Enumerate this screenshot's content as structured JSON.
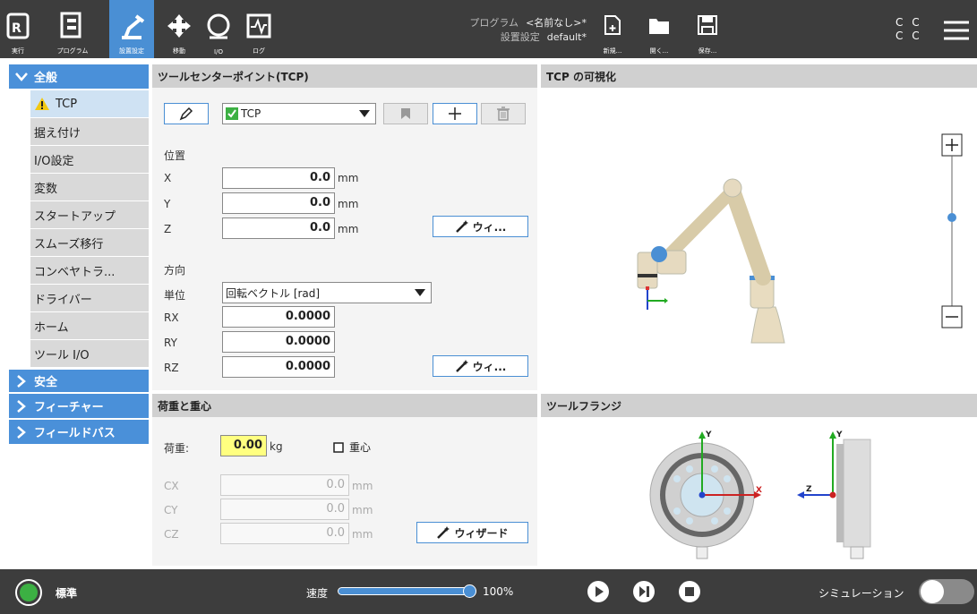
{
  "topbar": {
    "run": "実行",
    "program": "プログラム",
    "installation": "設置設定",
    "move": "移動",
    "io": "I/O",
    "log": "ログ",
    "program_label": "プログラム",
    "program_value": "<名前なし>*",
    "install_label": "設置設定",
    "install_value": "default*",
    "new": "新規...",
    "open": "開く...",
    "save": "保存...",
    "cc1": "C C",
    "cc2": "C C"
  },
  "sidebar": {
    "general": "全般",
    "items": [
      "TCP",
      "据え付け",
      "I/O設定",
      "変数",
      "スタートアップ",
      "スムーズ移行",
      "コンベヤトラ...",
      "ドライバー",
      "ホーム",
      "ツール I/O"
    ],
    "safety": "安全",
    "features": "フィーチャー",
    "fieldbus": "フィールドバス"
  },
  "tcp": {
    "title": "ツールセンターポイント(TCP)",
    "dropdown": "TCP",
    "position": "位置",
    "x_label": "X",
    "x": "0.0",
    "y_label": "Y",
    "y": "0.0",
    "z_label": "Z",
    "z": "0.0",
    "unit_mm": "mm",
    "wizard_short": "ウィ...",
    "orientation": "方向",
    "unit_label": "単位",
    "unit_value": "回転ベクトル [rad]",
    "rx_label": "RX",
    "rx": "0.0000",
    "ry_label": "RY",
    "ry": "0.0000",
    "rz_label": "RZ",
    "rz": "0.0000"
  },
  "viz": {
    "title": "TCP の可視化"
  },
  "payload": {
    "title": "荷重と重心",
    "payload_label": "荷重:",
    "payload_value": "0.00",
    "kg": "kg",
    "cog": "重心",
    "cx_label": "CX",
    "cx": "0.0",
    "cy_label": "CY",
    "cy": "0.0",
    "cz_label": "CZ",
    "cz": "0.0",
    "wizard": "ウィザード"
  },
  "flange": {
    "title": "ツールフランジ",
    "y": "Y",
    "x": "X",
    "z": "Z"
  },
  "bottom": {
    "mode": "標準",
    "speed_label": "速度",
    "speed": "100%",
    "speed_fraction": 1.0,
    "simulation": "シミュレーション"
  },
  "colors": {
    "accent": "#4a90d9",
    "topbar": "#3d3d3d",
    "highlight": "#ffff80"
  }
}
